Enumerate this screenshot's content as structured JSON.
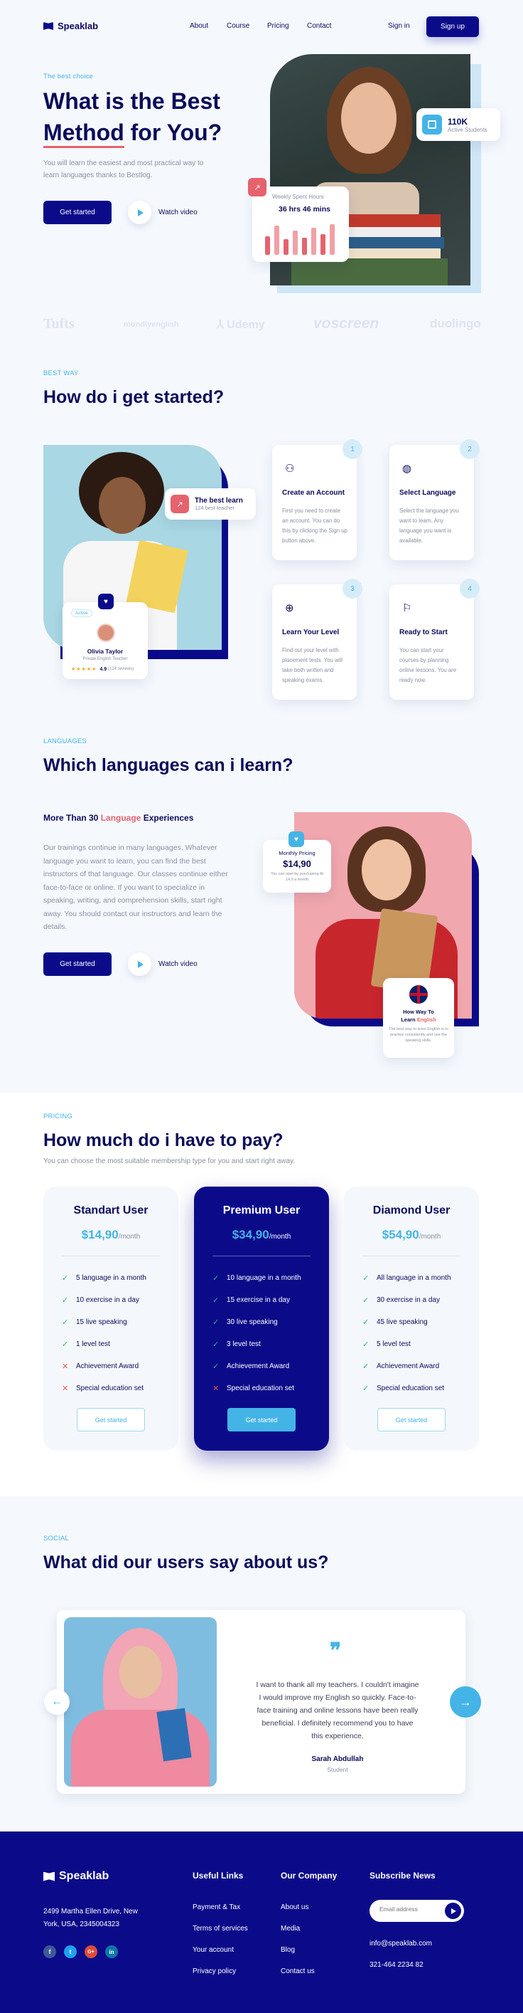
{
  "nav": {
    "brand": "Speaklab",
    "links": [
      "About",
      "Course",
      "Pricing",
      "Contact"
    ],
    "signin": "Sign in",
    "signup": "Sign up"
  },
  "hero": {
    "eyebrow": "The best choice",
    "title1": "What is the Best",
    "title2a": "Method",
    "title2b": " for You?",
    "subtitle": "You will learn the easiest and most practical way to learn languages thanks to Bestlog.",
    "cta": "Get started",
    "watch": "Watch video",
    "students_count": "110K",
    "students_label": "Active Students",
    "spent_title": "Weekly Spent Hours",
    "spent_value": "36 hrs 46 mins",
    "bar_levels": [
      0.55,
      0.85,
      0.45,
      0.7,
      0.5,
      0.8,
      0.6,
      0.9
    ]
  },
  "logos": [
    "Tufts",
    "mondlyenglish",
    "Udemy",
    "voscreen",
    "duolingo"
  ],
  "start": {
    "eyebrow": "BEST WAY",
    "title": "How do i get started?",
    "best_title": "The best learn",
    "best_sub": "124 best teacher",
    "teacher_badge": "Active",
    "teacher_name": "Olivia Taylor",
    "teacher_role": "Private English Teacher",
    "teacher_rating": "4.9",
    "teacher_reviews": "(124 reviews)",
    "steps": [
      {
        "num": "1",
        "icon": "user-icon",
        "title": "Create an Account",
        "text": "First you need to create an account. You can do this by clicking the Sign up button above."
      },
      {
        "num": "2",
        "icon": "globe-icon",
        "title": "Select Language",
        "text": "Select the language you want to learn. Any language you want is available."
      },
      {
        "num": "3",
        "icon": "target-icon",
        "title": "Learn Your Level",
        "text": "Find out your level with placement tests. You will take both written and speaking exams."
      },
      {
        "num": "4",
        "icon": "flag-icon",
        "title": "Ready to Start",
        "text": "You can start your courses by planning online lessons. You are ready now."
      }
    ]
  },
  "languages": {
    "eyebrow": "LANGUAGES",
    "title": "Which languages can i learn?",
    "sub_a": "More Than 30 ",
    "sub_b": "Language",
    "sub_c": " Experiences",
    "body": "Our trainings continue in many languages. Whatever language you want to learn, you can find the best instructors of that language. Our classes continue either face-to-face or online. If you want to specialize in speaking, writing, and comprehension skills, start right away. You should contact our instructors and learn the details.",
    "cta": "Get started",
    "watch": "Watch video",
    "price_label": "Monthly Pricing",
    "price_value": "$14,90",
    "price_note": "You can start by purchasing At 14.9 a month",
    "howto_a": "How Way To",
    "howto_b": "Learn ",
    "howto_c": "English",
    "howto_text": "The best way to learn English is to practice consistently and use the speaking skills."
  },
  "pricing": {
    "eyebrow": "PRICING",
    "title": "How much do i have to pay?",
    "subtitle": "You can choose the most suitable membership type for you and start right away.",
    "per": "/month",
    "plans": [
      {
        "name": "Standart User",
        "price": "$14,90",
        "cta": "Get started",
        "features": [
          {
            "t": "5 language in a month",
            "ok": true
          },
          {
            "t": "10 exercise in a day",
            "ok": true
          },
          {
            "t": "15 live speaking",
            "ok": true
          },
          {
            "t": "1 level test",
            "ok": true
          },
          {
            "t": "Achievement Award",
            "ok": false
          },
          {
            "t": "Special education set",
            "ok": false
          }
        ]
      },
      {
        "name": "Premium User",
        "price": "$34,90",
        "cta": "Get started",
        "features": [
          {
            "t": "10 language in a month",
            "ok": true
          },
          {
            "t": "15 exercise in a day",
            "ok": true
          },
          {
            "t": "30 live speaking",
            "ok": true
          },
          {
            "t": "3 level test",
            "ok": true
          },
          {
            "t": "Achievement Award",
            "ok": true
          },
          {
            "t": "Special education set",
            "ok": false
          }
        ]
      },
      {
        "name": "Diamond User",
        "price": "$54,90",
        "cta": "Get started",
        "features": [
          {
            "t": "All language in a month",
            "ok": true
          },
          {
            "t": "30 exercise in a day",
            "ok": true
          },
          {
            "t": "45 live speaking",
            "ok": true
          },
          {
            "t": "5 level test",
            "ok": true
          },
          {
            "t": "Achievement Award",
            "ok": true
          },
          {
            "t": "Special education set",
            "ok": true
          }
        ]
      }
    ]
  },
  "social": {
    "eyebrow": "SOCIAL",
    "title": "What did our users say about us?",
    "quote": "I want to thank all my teachers. I couldn't imagine I would improve my English so quickly. Face-to-face training and online lessons have been really beneficial. I definitely recommend you to have this experience.",
    "name": "Sarah Abdullah",
    "role": "Student"
  },
  "footer": {
    "brand": "Speaklab",
    "address": "2499 Martha Ellen Drive, New York, USA, 2345004323",
    "col1_title": "Useful Links",
    "col1": [
      "Payment & Tax",
      "Terms of services",
      "Your account",
      "Privacy policy"
    ],
    "col2_title": "Our Company",
    "col2": [
      "About us",
      "Media",
      "Blog",
      "Contact us"
    ],
    "col3_title": "Subscribe News",
    "email_placeholder": "Email address",
    "email": "info@speaklab.com",
    "phone": "321-464 2234 82",
    "social": [
      "f",
      "t",
      "G+",
      "in"
    ]
  },
  "colors": {
    "navy": "#0b0b8a",
    "sky": "#44b4e6",
    "coral": "#e5636d",
    "bg": "#f5f9fe"
  }
}
